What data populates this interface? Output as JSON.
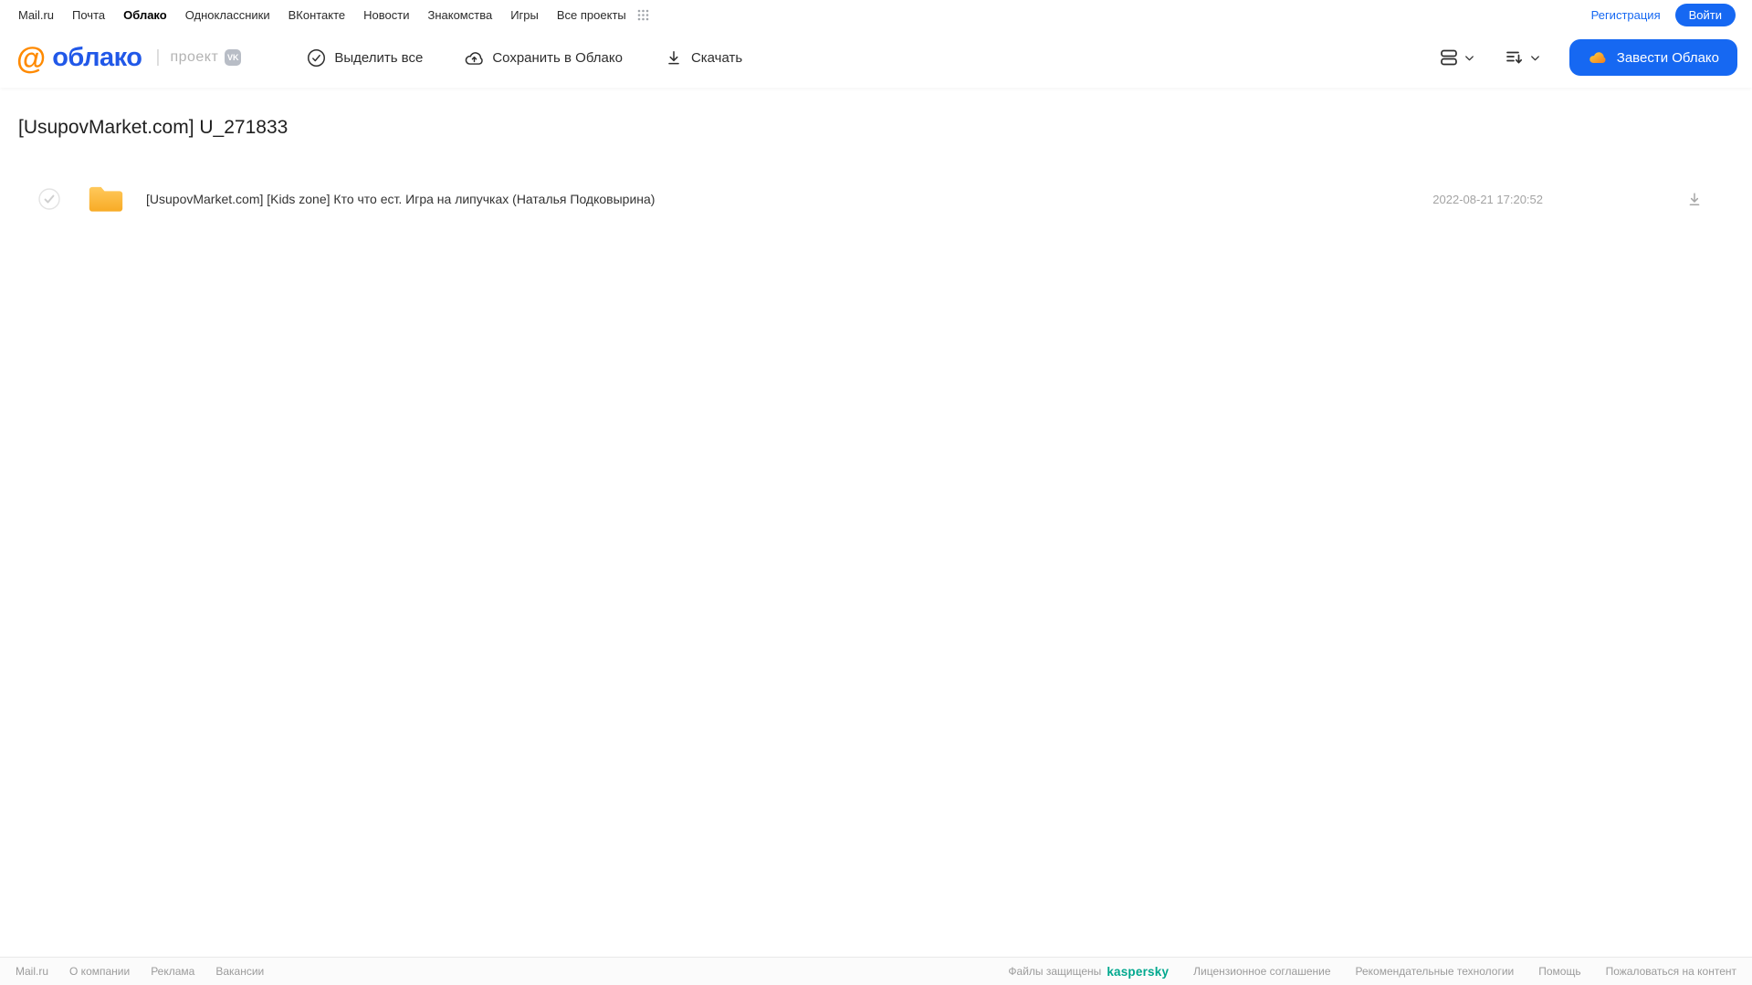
{
  "topnav": {
    "items": [
      "Mail.ru",
      "Почта",
      "Облако",
      "Одноклассники",
      "ВКонтакте",
      "Новости",
      "Знакомства",
      "Игры",
      "Все проекты"
    ],
    "registration": "Регистрация",
    "login": "Войти"
  },
  "header": {
    "logo_at": "@",
    "logo_text": "облако",
    "separator": "|",
    "project": "проект",
    "vk_badge": "VK",
    "toolbar": {
      "select_all": "Выделить все",
      "save_to_cloud": "Сохранить в Облако",
      "download": "Скачать"
    },
    "create_cloud": "Завести Облако"
  },
  "main": {
    "title": "[UsupovMarket.com] U_271833",
    "files": [
      {
        "type": "folder",
        "name": "[UsupovMarket.com] [Kids zone] Кто что ест. Игра на липучках (Наталья Подковырина)",
        "date": "2022-08-21 17:20:52"
      }
    ]
  },
  "footer": {
    "left_links": [
      "Mail.ru",
      "О компании",
      "Реклама",
      "Вакансии"
    ],
    "protected_by": "Файлы защищены",
    "kaspersky": "kaspersky",
    "right_links": [
      "Лицензионное соглашение",
      "Рекомендательные технологии",
      "Помощь",
      "Пожаловаться на контент"
    ]
  },
  "colors": {
    "accent_blue": "#1668F2",
    "logo_blue": "#2158E8",
    "logo_orange": "#FF8A00",
    "folder_orange": "#FBB545",
    "kaspersky_teal": "#00A88E"
  }
}
